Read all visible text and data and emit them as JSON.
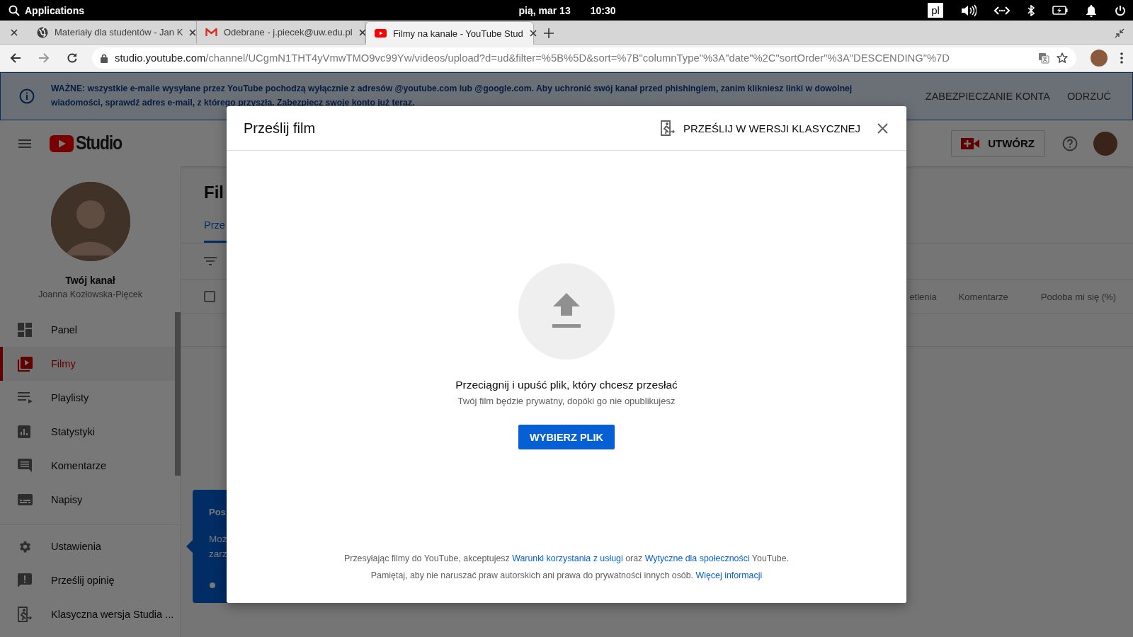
{
  "system_bar": {
    "menu": "Applications",
    "date": "pią, mar 13",
    "time": "10:30",
    "keyboard_layout": "pl"
  },
  "browser": {
    "tabs": [
      {
        "kind": "globe",
        "title": "Materiały dla studentów - Jan K",
        "selected": false
      },
      {
        "kind": "mail",
        "title": "Odebrane - j.piecek@uw.edu.pl",
        "selected": false
      },
      {
        "kind": "video",
        "title": "Filmy na kanale - YouTube Stud",
        "selected": true
      }
    ],
    "url": {
      "host": "studio.youtube.com",
      "path": "/channel/UCgmN1THT4yVmwTMO9vc99Yw/videos/upload?d=ud&filter=%5B%5D&sort=%7B\"columnType\"%3A\"date\"%2C\"sortOrder\"%3A\"DESCENDING\"%7D"
    }
  },
  "banner": {
    "text": "WAŻNE: wszystkie e-maile wysyłane przez YouTube pochodzą wyłącznie z adresów @youtube.com lub @google.com. Aby uchronić swój kanał przed phishingiem, zanim klikniesz linki w dowolnej wiadomości, sprawdź adres e-mail, z którego przyszła. Zabezpiecz swoje konto już teraz.",
    "actions": [
      "ZABEZPIECZANIE KONTA",
      "ODRZUĆ"
    ]
  },
  "header": {
    "logo": "Studio",
    "create_button": "UTWÓRZ"
  },
  "sidebar": {
    "channel_title": "Twój kanał",
    "channel_name": "Joanna Kozłowska-Pięcek",
    "items": [
      {
        "kind": "dashboard",
        "label": "Panel",
        "selected": false
      },
      {
        "kind": "videos",
        "label": "Filmy",
        "selected": true
      },
      {
        "kind": "playlists",
        "label": "Playlisty",
        "selected": false
      },
      {
        "kind": "analytics",
        "label": "Statystyki",
        "selected": false
      },
      {
        "kind": "comments",
        "label": "Komentarze",
        "selected": false
      },
      {
        "kind": "subtitles",
        "label": "Napisy",
        "selected": false
      },
      {
        "kind": "divider"
      },
      {
        "kind": "settings",
        "label": "Ustawienia",
        "selected": false
      },
      {
        "kind": "feedback",
        "label": "Prześlij opinię",
        "selected": false
      },
      {
        "kind": "classic",
        "label": "Klasyczna wersja Studia ...",
        "selected": false
      }
    ]
  },
  "main": {
    "title": "Fil",
    "tab": "Prze",
    "select_all": {
      "checked": false
    },
    "columns": [
      "etlenia",
      "Komentarze",
      "Podoba mi się (%)"
    ],
    "popup": {
      "title": "Pos",
      "lines": [
        "Moż",
        "zarz"
      ]
    }
  },
  "dialog": {
    "title": "Prześlij film",
    "classic_link": "PRZEŚLIJ W WERSJI KLASYCZNEJ",
    "drop_title": "Przeciągnij i upuść plik, który chcesz przesłać",
    "drop_subtitle": "Twój film będzie prywatny, dopóki go nie opublikujesz",
    "button": "WYBIERZ PLIK",
    "terms": [
      {
        "parts": [
          {
            "kind": "text",
            "text": "Przesyłając filmy do YouTube, akceptujesz "
          },
          {
            "kind": "link",
            "text": "Warunki korzystania z usługi"
          },
          {
            "kind": "text",
            "text": " oraz "
          },
          {
            "kind": "link",
            "text": "Wytyczne dla społeczności"
          },
          {
            "kind": "text",
            "text": " YouTube."
          }
        ]
      },
      {
        "parts": [
          {
            "kind": "text",
            "text": "Pamiętaj, aby nie naruszać praw autorskich ani prawa do prywatności innych osób. "
          },
          {
            "kind": "link",
            "text": "Więcej informacji"
          }
        ]
      }
    ]
  }
}
